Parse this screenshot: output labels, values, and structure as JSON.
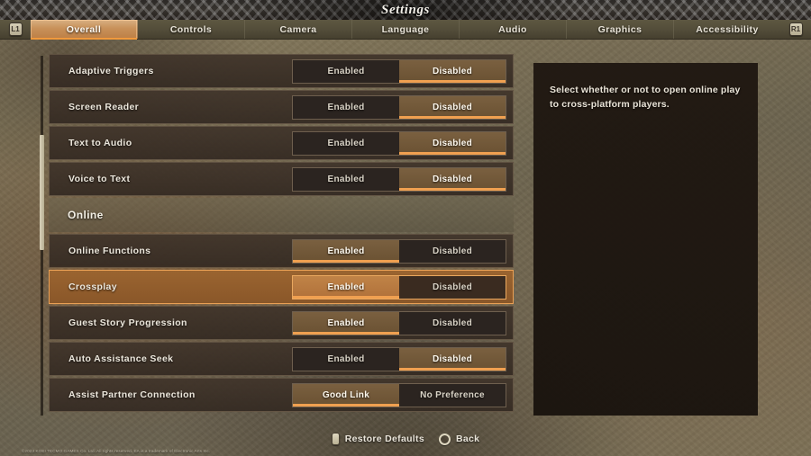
{
  "header": {
    "title": "Settings",
    "left_shoulder": "L1",
    "right_shoulder": "R1"
  },
  "tabs": [
    {
      "label": "Overall",
      "active": true
    },
    {
      "label": "Controls",
      "active": false
    },
    {
      "label": "Camera",
      "active": false
    },
    {
      "label": "Language",
      "active": false
    },
    {
      "label": "Audio",
      "active": false
    },
    {
      "label": "Graphics",
      "active": false
    },
    {
      "label": "Accessibility",
      "active": false
    }
  ],
  "settings": [
    {
      "kind": "row",
      "label": "Adaptive Triggers",
      "options": [
        "Enabled",
        "Disabled"
      ],
      "selected": 1,
      "highlighted": false
    },
    {
      "kind": "row",
      "label": "Screen Reader",
      "options": [
        "Enabled",
        "Disabled"
      ],
      "selected": 1,
      "highlighted": false
    },
    {
      "kind": "row",
      "label": "Text to Audio",
      "options": [
        "Enabled",
        "Disabled"
      ],
      "selected": 1,
      "highlighted": false
    },
    {
      "kind": "row",
      "label": "Voice to Text",
      "options": [
        "Enabled",
        "Disabled"
      ],
      "selected": 1,
      "highlighted": false
    },
    {
      "kind": "section",
      "label": "Online"
    },
    {
      "kind": "row",
      "label": "Online Functions",
      "options": [
        "Enabled",
        "Disabled"
      ],
      "selected": 0,
      "highlighted": false
    },
    {
      "kind": "row",
      "label": "Crossplay",
      "options": [
        "Enabled",
        "Disabled"
      ],
      "selected": 0,
      "highlighted": true
    },
    {
      "kind": "row",
      "label": "Guest Story Progression",
      "options": [
        "Enabled",
        "Disabled"
      ],
      "selected": 0,
      "highlighted": false
    },
    {
      "kind": "row",
      "label": "Auto Assistance Seek",
      "options": [
        "Enabled",
        "Disabled"
      ],
      "selected": 1,
      "highlighted": false
    },
    {
      "kind": "row",
      "label": "Assist Partner Connection",
      "options": [
        "Good Link",
        "No Preference"
      ],
      "selected": 0,
      "highlighted": false
    }
  ],
  "description": {
    "text": "Select whether or not to open online play to cross-platform players."
  },
  "footer": {
    "hints": [
      {
        "glyph": "touchpad-button-icon",
        "label": "Restore Defaults"
      },
      {
        "glyph": "circle-button-icon",
        "label": "Back"
      }
    ]
  },
  "copyright": "©2023 KOEI TECMO GAMES Co. Ltd. All rights reserved. EA is a trademark of Electronic Arts Inc.",
  "colors": {
    "accent_orange": "#f0a050",
    "selected_row": "#8a5729",
    "panel_dark": "#1e1610"
  }
}
